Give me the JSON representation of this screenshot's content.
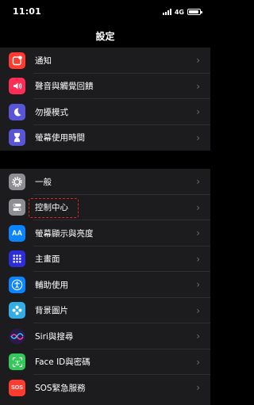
{
  "status_bar": {
    "time": "11:01",
    "network": "4G",
    "battery_level": 0.9
  },
  "nav": {
    "title": "設定"
  },
  "group1": [
    {
      "label": "通知",
      "icon": "notification-icon",
      "color": "#ff3b30"
    },
    {
      "label": "聲音與觸覺回饋",
      "icon": "speaker-icon",
      "color": "#ff2d55"
    },
    {
      "label": "勿擾模式",
      "icon": "moon-icon",
      "color": "#5856d6"
    },
    {
      "label": "螢幕使用時間",
      "icon": "hourglass-icon",
      "color": "#5856d6"
    }
  ],
  "group2": [
    {
      "label": "一般",
      "icon": "gear-icon",
      "color": "#8e8e93"
    },
    {
      "label": "控制中心",
      "icon": "toggles-icon",
      "color": "#8e8e93"
    },
    {
      "label": "螢幕顯示與亮度",
      "icon": "text-size-icon",
      "color": "#0a84ff"
    },
    {
      "label": "主畫面",
      "icon": "home-grid-icon",
      "color": "#2c2cd9"
    },
    {
      "label": "輔助使用",
      "icon": "accessibility-icon",
      "color": "#0a84ff"
    },
    {
      "label": "背景圖片",
      "icon": "wallpaper-icon",
      "color": "#32ade6"
    },
    {
      "label": "Siri與搜尋",
      "icon": "siri-icon",
      "color": "#1c1c1e"
    },
    {
      "label": "Face ID與密碼",
      "icon": "faceid-icon",
      "color": "#34c759"
    },
    {
      "label": "SOS緊急服務",
      "icon": "sos-icon",
      "color": "#ff3b30"
    }
  ]
}
